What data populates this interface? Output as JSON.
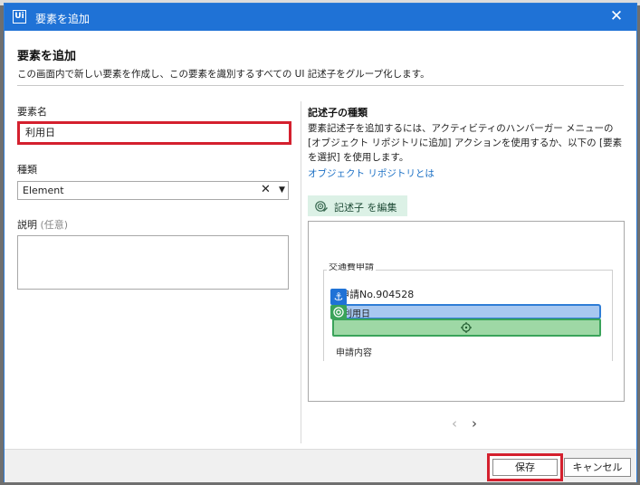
{
  "dialog": {
    "title": "要素を追加",
    "close_glyph": "✕"
  },
  "header": {
    "title": "要素を追加",
    "description": "この画面内で新しい要素を作成し、この要素を識別するすべての UI 記述子をグループ化します。"
  },
  "left": {
    "name_label": "要素名",
    "name_value": "利用日",
    "type_label": "種類",
    "type_value": "Element",
    "description_label": "説明",
    "description_optional": "(任意)"
  },
  "right": {
    "title": "記述子の種類",
    "description": "要素記述子を追加するには、アクティビティのハンバーガー メニューの [オブジェクト リポジトリに追加] アクションを使用するか、以下の [要素を選択] を使用します。",
    "link": "オブジェクト リポジトリとは",
    "edit_button": "記述子 を編集"
  },
  "preview": {
    "form_title": "交通費申請",
    "application_no": "申請No.904528",
    "field_label": "利用日",
    "section_label": "申請内容",
    "anchor_glyph": "⚓"
  },
  "pager": {
    "prev": "‹",
    "next": "›"
  },
  "footer": {
    "save": "保存",
    "cancel": "キャンセル"
  },
  "colors": {
    "titlebar": "#1f72d6",
    "highlight_red": "#d4202e",
    "link": "#1a6fc4",
    "target_blue": "#a8c8f0",
    "anchor_green": "#9ed8a5"
  },
  "icons": [
    "ui-logo-icon",
    "close-icon",
    "clear-icon",
    "chevron-down-icon",
    "target-edit-icon",
    "anchor-icon",
    "target-icon",
    "crosshair-icon",
    "chevron-left-icon",
    "chevron-right-icon"
  ]
}
